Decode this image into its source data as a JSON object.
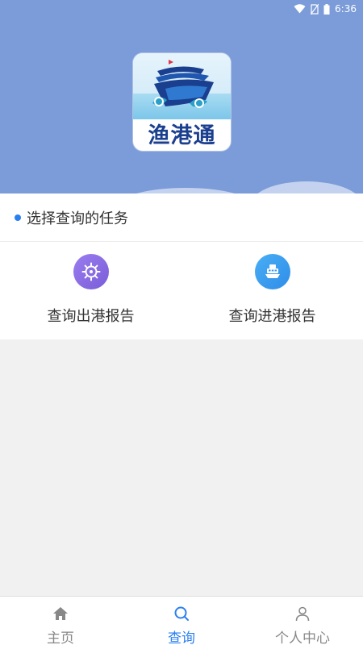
{
  "status_bar": {
    "time": "6:36"
  },
  "logo": {
    "text": "渔港通"
  },
  "section": {
    "title": "选择查询的任务"
  },
  "options": [
    {
      "label": "查询出港报告",
      "icon": "ship-wheel-icon",
      "color": "#8a6ce6"
    },
    {
      "label": "查询进港报告",
      "icon": "ferry-icon",
      "color": "#3a9bf0"
    }
  ],
  "tabs": [
    {
      "label": "主页",
      "icon": "home-icon",
      "active": false
    },
    {
      "label": "查询",
      "icon": "search-icon",
      "active": true
    },
    {
      "label": "个人中心",
      "icon": "user-icon",
      "active": false
    }
  ],
  "colors": {
    "header": "#7b9cd8",
    "accent": "#2a7ff0",
    "background": "#f1f1f1"
  }
}
